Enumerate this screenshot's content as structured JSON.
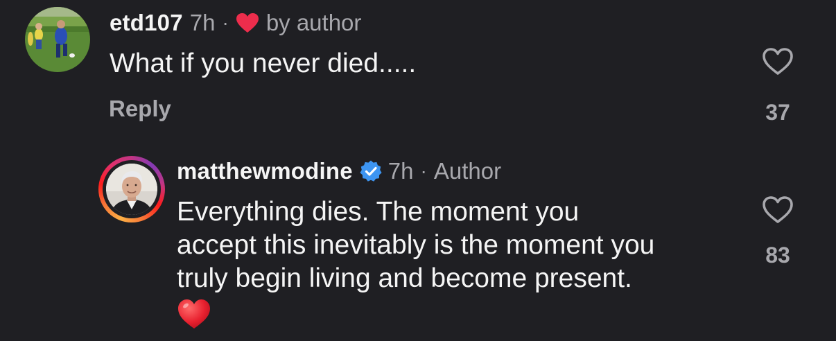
{
  "comments": [
    {
      "username": "etd107",
      "time": "7h",
      "separator": "·",
      "liked_label": "by author",
      "text": "What if you never died.....",
      "reply_label": "Reply",
      "like_count": "37",
      "avatar_icon": "soccer-photo-avatar",
      "liked_icon": "red-heart-icon"
    },
    {
      "username": "matthewmodine",
      "verified": true,
      "verified_icon": "verified-badge-icon",
      "time": "7h",
      "separator": "·",
      "author_label": "Author",
      "text_lines": [
        "Everything dies. The moment you",
        "accept this inevitably is the moment you",
        "truly begin living and become present."
      ],
      "emoji": "red-heart-emoji",
      "like_count": "83",
      "avatar_icon": "portrait-avatar-with-story-ring"
    }
  ],
  "colors": {
    "background": "#1f1f23",
    "primary_text": "#f5f5f5",
    "secondary_text": "#a8a8ad",
    "heart_red": "#ed2d4c",
    "verified_blue": "#3d95f2"
  }
}
